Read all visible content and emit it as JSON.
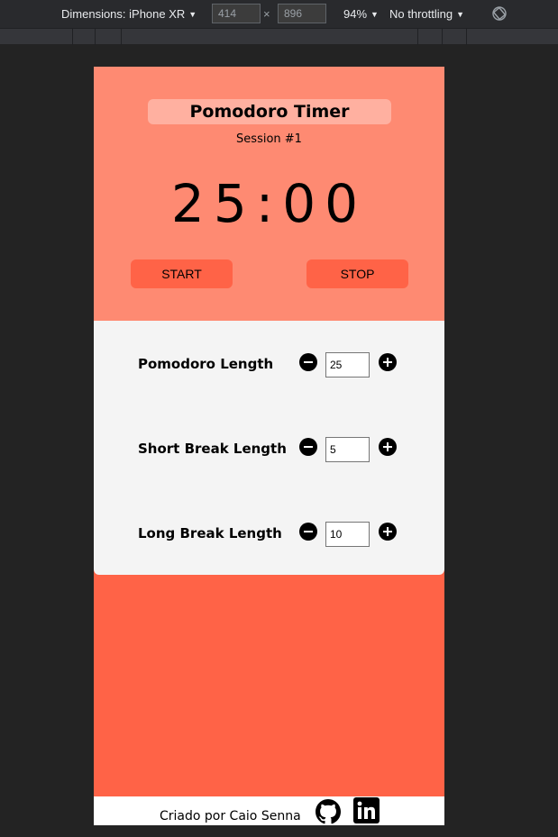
{
  "devtools": {
    "dimensions_label": "Dimensions: iPhone XR",
    "width_value": "414",
    "times": "×",
    "height_value": "896",
    "zoom": "94%",
    "throttling": "No throttling",
    "arrow": "▼"
  },
  "app": {
    "title": "Pomodoro Timer",
    "session": "Session #1",
    "timer": "25:00",
    "start_label": "START",
    "stop_label": "STOP",
    "accent_color": "#ff6347",
    "panel_color": "#fe8a72"
  },
  "settings": [
    {
      "label": "Pomodoro Length",
      "value": "25"
    },
    {
      "label": "Short Break Length",
      "value": "5"
    },
    {
      "label": "Long Break Length",
      "value": "10"
    }
  ],
  "footer": {
    "credit": "Criado por Caio Senna",
    "icons": [
      "github-icon",
      "linkedin-icon"
    ]
  }
}
